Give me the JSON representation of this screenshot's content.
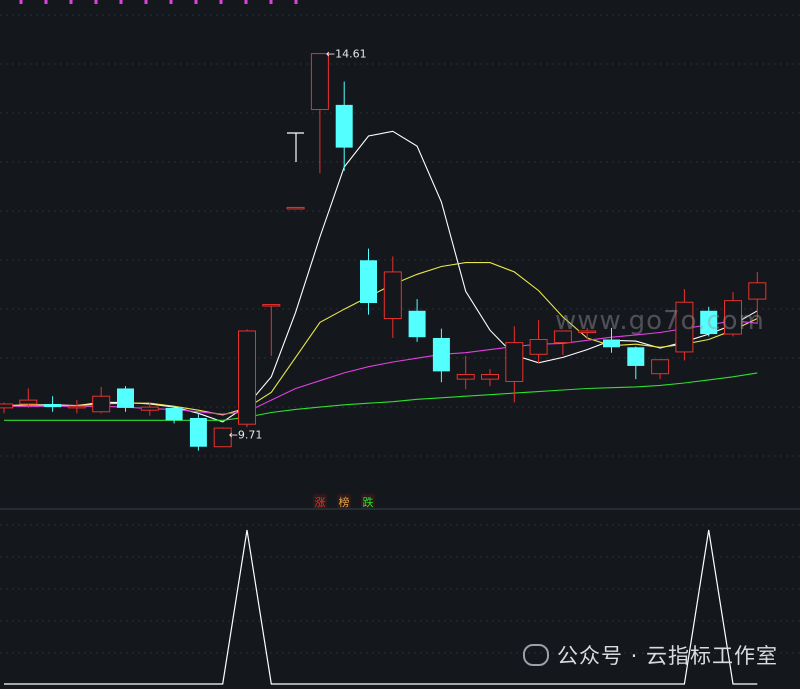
{
  "chart_data": [
    {
      "type": "candlestick",
      "title": "",
      "ylim": [
        8.8,
        15.3
      ],
      "grid": true,
      "colors": {
        "up": "#e8322e",
        "down": "#54ffff",
        "ma1": "#ffffff",
        "ma2": "#e8e84a",
        "ma3": "#e040e0",
        "ma4": "#2ee02e"
      },
      "candles": [
        {
          "o": 10.05,
          "h": 10.12,
          "l": 9.98,
          "c": 10.1
        },
        {
          "o": 10.1,
          "h": 10.3,
          "l": 10.05,
          "c": 10.15
        },
        {
          "o": 10.1,
          "h": 10.2,
          "l": 10.0,
          "c": 10.06
        },
        {
          "o": 10.05,
          "h": 10.15,
          "l": 9.98,
          "c": 10.07
        },
        {
          "o": 10.0,
          "h": 10.32,
          "l": 9.98,
          "c": 10.2
        },
        {
          "o": 10.3,
          "h": 10.33,
          "l": 10.0,
          "c": 10.05
        },
        {
          "o": 10.02,
          "h": 10.12,
          "l": 9.95,
          "c": 10.06
        },
        {
          "o": 10.05,
          "h": 10.08,
          "l": 9.85,
          "c": 9.89
        },
        {
          "o": 9.92,
          "h": 9.98,
          "l": 9.5,
          "c": 9.55
        },
        {
          "o": 9.55,
          "h": 9.8,
          "l": 9.71,
          "c": 9.79
        },
        {
          "o": 9.84,
          "h": 11.06,
          "l": 9.8,
          "c": 11.04
        },
        {
          "o": 11.38,
          "h": 11.38,
          "l": 10.72,
          "c": 11.38
        },
        {
          "o": 12.63,
          "h": 12.63,
          "l": 12.63,
          "c": 12.63
        },
        {
          "o": 13.89,
          "h": 14.61,
          "l": 13.07,
          "c": 14.61
        },
        {
          "o": 13.95,
          "h": 14.25,
          "l": 13.1,
          "c": 13.4
        },
        {
          "o": 11.95,
          "h": 12.1,
          "l": 11.25,
          "c": 11.4
        },
        {
          "o": 11.2,
          "h": 12.0,
          "l": 10.95,
          "c": 11.8
        },
        {
          "o": 11.3,
          "h": 11.45,
          "l": 10.9,
          "c": 10.96
        },
        {
          "o": 10.95,
          "h": 11.07,
          "l": 10.38,
          "c": 10.52
        },
        {
          "o": 10.42,
          "h": 10.72,
          "l": 10.29,
          "c": 10.48
        },
        {
          "o": 10.42,
          "h": 10.55,
          "l": 10.33,
          "c": 10.48
        },
        {
          "o": 10.39,
          "h": 11.1,
          "l": 10.12,
          "c": 10.89
        },
        {
          "o": 10.74,
          "h": 11.18,
          "l": 10.62,
          "c": 10.93
        },
        {
          "o": 10.89,
          "h": 11.04,
          "l": 10.73,
          "c": 11.04
        },
        {
          "o": 11.02,
          "h": 11.08,
          "l": 10.94,
          "c": 11.04
        },
        {
          "o": 10.93,
          "h": 11.08,
          "l": 10.76,
          "c": 10.83
        },
        {
          "o": 10.83,
          "h": 10.84,
          "l": 10.42,
          "c": 10.59
        },
        {
          "o": 10.49,
          "h": 10.67,
          "l": 10.42,
          "c": 10.67
        },
        {
          "o": 10.77,
          "h": 11.58,
          "l": 10.66,
          "c": 11.41
        },
        {
          "o": 11.3,
          "h": 11.35,
          "l": 10.97,
          "c": 11.0
        },
        {
          "o": 11.0,
          "h": 11.54,
          "l": 10.97,
          "c": 11.43
        },
        {
          "o": 11.45,
          "h": 11.8,
          "l": 11.13,
          "c": 11.66
        }
      ],
      "ma_lines": [
        {
          "color": "#ffffff",
          "values": [
            10.07,
            10.09,
            10.09,
            10.08,
            10.12,
            10.12,
            10.1,
            10.06,
            9.98,
            9.87,
            10.08,
            10.45,
            11.28,
            12.25,
            13.15,
            13.55,
            13.61,
            13.42,
            12.7,
            11.55,
            11.05,
            10.73,
            10.63,
            10.7,
            10.8,
            10.92,
            10.91,
            10.82,
            10.9,
            11.0,
            11.12,
            11.3
          ]
        },
        {
          "color": "#e8e84a",
          "values": [
            10.08,
            10.09,
            10.08,
            10.08,
            10.1,
            10.11,
            10.11,
            10.07,
            10.02,
            9.96,
            10.05,
            10.25,
            10.7,
            11.15,
            11.32,
            11.48,
            11.64,
            11.77,
            11.87,
            11.92,
            11.92,
            11.8,
            11.56,
            11.22,
            10.95,
            10.85,
            10.87,
            10.83,
            10.87,
            10.93,
            11.05,
            11.2
          ]
        },
        {
          "color": "#e040e0",
          "values": [
            10.07,
            10.07,
            10.07,
            10.07,
            10.07,
            10.06,
            10.04,
            10.03,
            10.0,
            9.97,
            10.0,
            10.15,
            10.3,
            10.4,
            10.5,
            10.58,
            10.64,
            10.69,
            10.74,
            10.76,
            10.8,
            10.84,
            10.87,
            10.88,
            10.92,
            10.96,
            10.99,
            11.02,
            11.07,
            11.12,
            11.17,
            11.14
          ]
        },
        {
          "color": "#2ee02e",
          "values": [
            9.89,
            9.89,
            9.89,
            9.89,
            9.89,
            9.89,
            9.89,
            9.89,
            9.89,
            9.89,
            9.93,
            9.99,
            10.03,
            10.06,
            10.09,
            10.11,
            10.13,
            10.16,
            10.18,
            10.2,
            10.22,
            10.24,
            10.26,
            10.28,
            10.3,
            10.31,
            10.32,
            10.34,
            10.37,
            10.41,
            10.45,
            10.5
          ]
        }
      ],
      "annotations": [
        {
          "text": "14.61",
          "candle": 13,
          "value": 14.61
        },
        {
          "text": "9.71",
          "candle": 9,
          "value": 9.71
        }
      ],
      "legend": [
        "涨",
        "榜",
        "跌"
      ]
    },
    {
      "type": "line",
      "ylim": [
        0,
        1
      ],
      "grid": true,
      "color": "#ffffff",
      "values": [
        0,
        0,
        0,
        0,
        0,
        0,
        0,
        0,
        0,
        0,
        1,
        0,
        0,
        0,
        0,
        0,
        0,
        0,
        0,
        0,
        0,
        0,
        0,
        0,
        0,
        0,
        0,
        0,
        0,
        1,
        0,
        0
      ]
    }
  ],
  "watermark": {
    "site": "www.go7o.com",
    "account": "公众号 · 云指标工作室"
  }
}
